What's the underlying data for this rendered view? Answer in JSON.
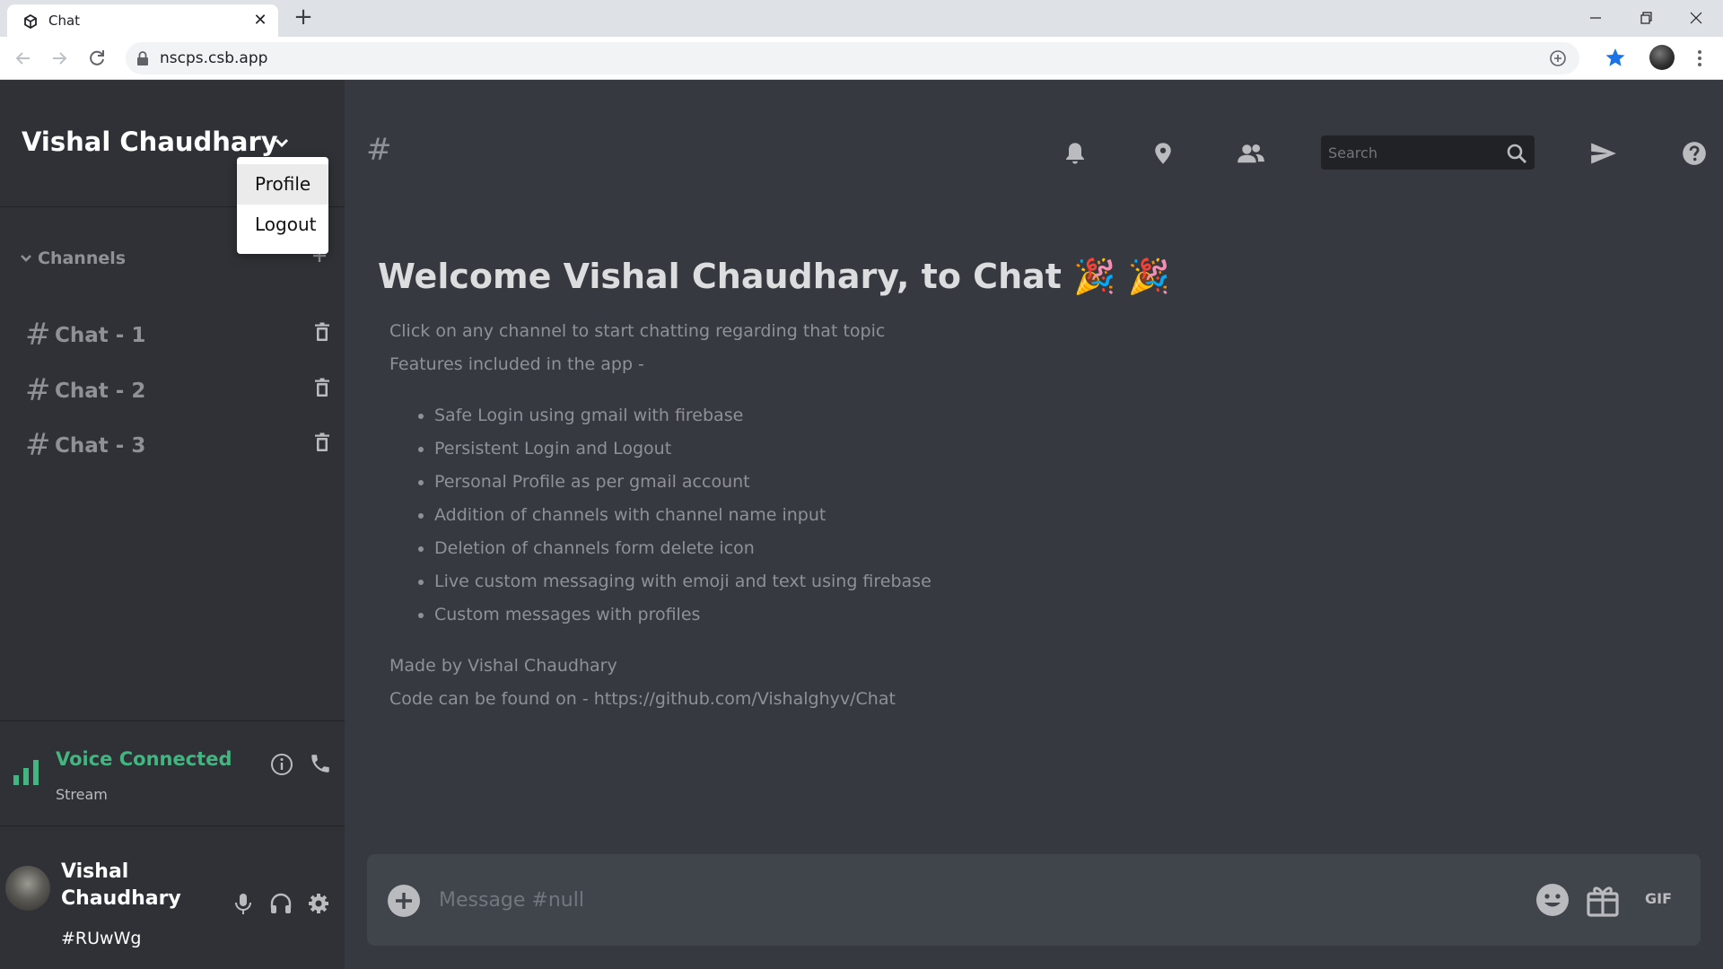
{
  "browser": {
    "tab_title": "Chat",
    "url": "nscps.csb.app"
  },
  "sidebar": {
    "server_name": "Vishal Chaudhary",
    "dropdown_items": [
      "Profile",
      "Logout"
    ],
    "channels_label": "Channels",
    "channels": [
      {
        "name": "Chat - 1"
      },
      {
        "name": "Chat - 2"
      },
      {
        "name": "Chat - 3"
      }
    ],
    "voice": {
      "status": "Voice Connected",
      "subtitle": "Stream"
    },
    "user": {
      "name": "Vishal Chaudhary",
      "tag": "#RUwWg"
    }
  },
  "header": {
    "hash": "#",
    "search_placeholder": "Search"
  },
  "main": {
    "welcome": "Welcome Vishal Chaudhary, to Chat 🎉 🎉",
    "intro_1": "Click on any channel to start chatting regarding that topic",
    "intro_2": "Features included in the app -",
    "features": [
      "Safe Login using gmail with firebase",
      "Persistent Login and Logout",
      "Personal Profile as per gmail account",
      "Addition of channels with channel name input",
      "Deletion of channels form delete icon",
      "Live custom messaging with emoji and text using firebase",
      "Custom messages with profiles"
    ],
    "made_by": "Made by Vishal Chaudhary",
    "code_link": "Code can be found on - https://github.com/Vishalghyv/Chat"
  },
  "composer": {
    "placeholder": "Message #null",
    "gif_label": "GIF"
  },
  "colors": {
    "background": "#36393f",
    "sidebar": "#2f3136",
    "voice_green": "#43b581",
    "muted": "#8e9297"
  }
}
